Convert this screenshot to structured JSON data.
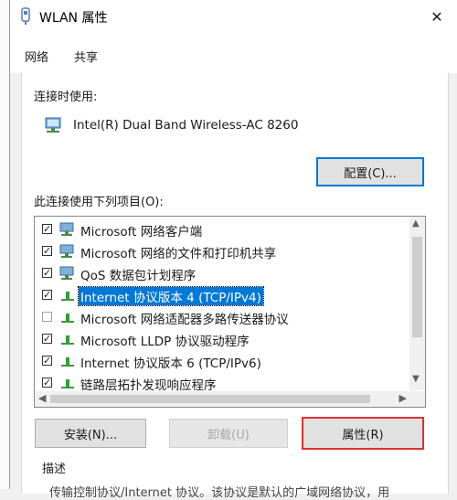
{
  "window": {
    "title": "WLAN 属性",
    "close_symbol": "✕"
  },
  "tabs": [
    {
      "label": "网络"
    },
    {
      "label": "共享"
    }
  ],
  "connect_using": {
    "label": "连接时使用:",
    "adapter": "Intel(R) Dual Band Wireless-AC 8260"
  },
  "buttons": {
    "configure": "配置(C)...",
    "install": "安装(N)...",
    "uninstall": "卸载(U)",
    "properties": "属性(R)"
  },
  "items_label": "此连接使用下列项目(O):",
  "items": [
    {
      "label": "Microsoft 网络客户端",
      "checked": true,
      "icon": "network-client-icon"
    },
    {
      "label": "Microsoft 网络的文件和打印机共享",
      "checked": true,
      "icon": "network-client-icon"
    },
    {
      "label": "QoS 数据包计划程序",
      "checked": true,
      "icon": "network-client-icon"
    },
    {
      "label": "Internet 协议版本 4 (TCP/IPv4)",
      "checked": true,
      "icon": "protocol-icon",
      "selected": true
    },
    {
      "label": "Microsoft 网络适配器多路传送器协议",
      "checked": false,
      "icon": "protocol-icon"
    },
    {
      "label": "Microsoft LLDP 协议驱动程序",
      "checked": true,
      "icon": "protocol-icon"
    },
    {
      "label": "Internet 协议版本 6 (TCP/IPv6)",
      "checked": true,
      "icon": "protocol-icon"
    },
    {
      "label": "链路层拓扑发现响应程序",
      "checked": true,
      "icon": "protocol-icon"
    }
  ],
  "description": {
    "label": "描述",
    "text": "传输控制协议/Internet 协议。该协议是默认的广域网络协议，用"
  },
  "colors": {
    "selection": "#0078d7",
    "highlight_border": "#e03030",
    "focus_border": "#0078d7"
  }
}
